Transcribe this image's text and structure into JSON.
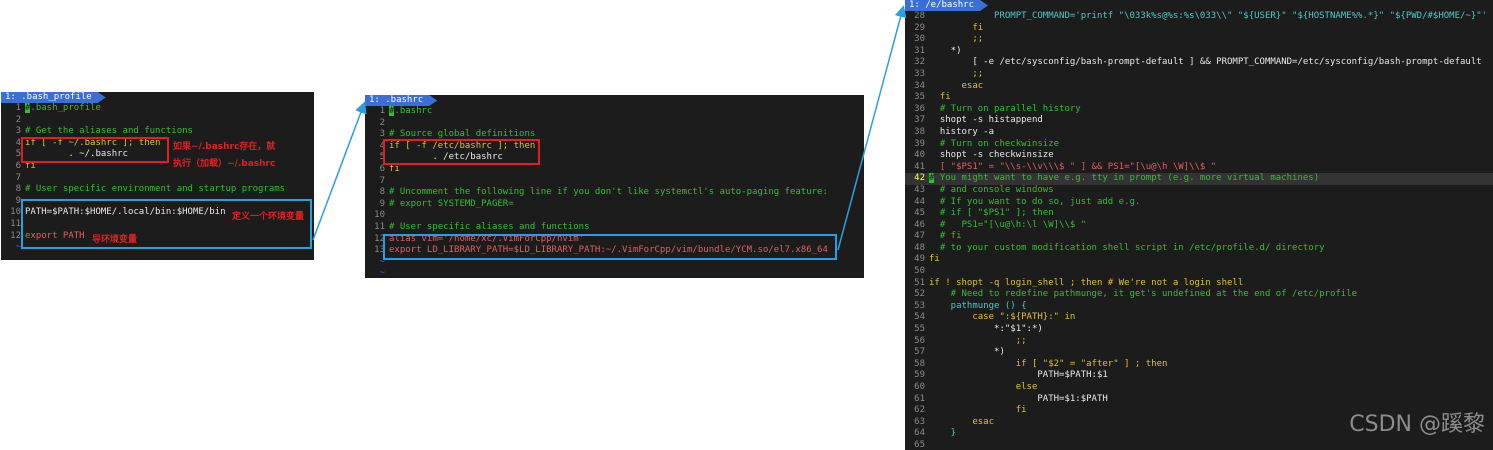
{
  "panel1": {
    "tab": "1: .bash_profile",
    "lines": [
      {
        "n": "1",
        "t": ".bash_profile",
        "c": "cmt",
        "cursor": "#"
      },
      {
        "n": "2",
        "t": "",
        "c": "plain"
      },
      {
        "n": "3",
        "t": "# Get the aliases and functions",
        "c": "cmt"
      },
      {
        "n": "4",
        "t": "if [ -f ~/.bashrc ]; then",
        "c": "kw"
      },
      {
        "n": "5",
        "t": "        . ~/.bashrc",
        "c": "plain"
      },
      {
        "n": "6",
        "t": "fi",
        "c": "kw"
      },
      {
        "n": "7",
        "t": "",
        "c": "plain"
      },
      {
        "n": "8",
        "t": "# User specific environment and startup programs",
        "c": "cmt"
      },
      {
        "n": "9",
        "t": "",
        "c": "plain"
      },
      {
        "n": "10",
        "t": "PATH=$PATH:$HOME/.local/bin:$HOME/bin",
        "c": "plain"
      },
      {
        "n": "11",
        "t": "",
        "c": "plain"
      },
      {
        "n": "12",
        "t": "export PATH",
        "c": "str"
      },
      {
        "n": "~",
        "t": "",
        "c": "tilde"
      }
    ],
    "anno1a": "如果~/.bashrc存在，就",
    "anno1b": "执行（加载）~/.bashrc",
    "anno2": "定义一个环境变量",
    "anno3": "导环境变量"
  },
  "panel2": {
    "tab": "1: .bashrc",
    "lines": [
      {
        "n": "1",
        "t": ".bashrc",
        "c": "cmt",
        "cursor": "#"
      },
      {
        "n": "2",
        "t": "",
        "c": "plain"
      },
      {
        "n": "3",
        "t": "# Source global definitions",
        "c": "cmt"
      },
      {
        "n": "4",
        "t": "if [ -f /etc/bashrc ]; then",
        "c": "kw"
      },
      {
        "n": "5",
        "t": "        . /etc/bashrc",
        "c": "plain"
      },
      {
        "n": "6",
        "t": "fi",
        "c": "kw"
      },
      {
        "n": "7",
        "t": "",
        "c": "plain"
      },
      {
        "n": "8",
        "t": "# Uncomment the following line if you don't like systemctl's auto-paging feature:",
        "c": "cmt"
      },
      {
        "n": "9",
        "t": "# export SYSTEMD_PAGER=",
        "c": "cmt"
      },
      {
        "n": "10",
        "t": "",
        "c": "plain"
      },
      {
        "n": "11",
        "t": "# User specific aliases and functions",
        "c": "cmt"
      },
      {
        "n": "12",
        "t": "alias vim='/home/xc/.VimForCpp/nvim'",
        "c": "str"
      },
      {
        "n": "13",
        "t": "export LD_LIBRARY_PATH=$LD_LIBRARY_PATH:~/.VimForCpp/vim/bundle/YCM.so/el7.x86_64",
        "c": "str"
      },
      {
        "n": "~",
        "t": "",
        "c": "tilde"
      },
      {
        "n": "~",
        "t": "",
        "c": "tilde"
      }
    ]
  },
  "panel3": {
    "tab": "1: /e/bashrc",
    "lines": [
      {
        "n": "28",
        "t": "            PROMPT_COMMAND='printf \"\\033k%s@%s:%s\\033\\\\\" \"${USER}\" \"${HOSTNAME%%.*}\" \"${PWD/#$HOME/~}\"'",
        "c": "cyan"
      },
      {
        "n": "29",
        "t": "        fi",
        "c": "kw"
      },
      {
        "n": "30",
        "t": "        ;;",
        "c": "kw"
      },
      {
        "n": "31",
        "t": "    *)",
        "c": "plain"
      },
      {
        "n": "32",
        "t": "        [ -e /etc/sysconfig/bash-prompt-default ] && PROMPT_COMMAND=/etc/sysconfig/bash-prompt-default",
        "c": "plain"
      },
      {
        "n": "33",
        "t": "        ;;",
        "c": "kw"
      },
      {
        "n": "34",
        "t": "      esac",
        "c": "kw"
      },
      {
        "n": "35",
        "t": "  fi",
        "c": "kw"
      },
      {
        "n": "36",
        "t": "  # Turn on parallel history",
        "c": "cmt"
      },
      {
        "n": "37",
        "t": "  shopt -s histappend",
        "c": "plain"
      },
      {
        "n": "38",
        "t": "  history -a",
        "c": "plain"
      },
      {
        "n": "39",
        "t": "  # Turn on checkwinsize",
        "c": "cmt"
      },
      {
        "n": "40",
        "t": "  shopt -s checkwinsize",
        "c": "plain"
      },
      {
        "n": "41",
        "t": "  [ \"$PS1\" = \"\\\\s-\\\\v\\\\\\$ \" ] && PS1=\"[\\u@\\h \\W]\\\\$ \"",
        "c": "str"
      },
      {
        "n": "42",
        "t": " You might want to have e.g. tty in prompt (e.g. more virtual machines)",
        "c": "cmt",
        "cursor": "#",
        "cur": true
      },
      {
        "n": "43",
        "t": "  # and console windows",
        "c": "cmt"
      },
      {
        "n": "44",
        "t": "  # If you want to do so, just add e.g.",
        "c": "cmt"
      },
      {
        "n": "45",
        "t": "  # if [ \"$PS1\" ]; then",
        "c": "cmt"
      },
      {
        "n": "46",
        "t": "  #   PS1=\"[\\u@\\h:\\l \\W]\\\\$ \"",
        "c": "cmt"
      },
      {
        "n": "47",
        "t": "  # fi",
        "c": "cmt"
      },
      {
        "n": "48",
        "t": "  # to your custom modification shell script in /etc/profile.d/ directory",
        "c": "cmt"
      },
      {
        "n": "49",
        "t": "fi",
        "c": "kw"
      },
      {
        "n": "50",
        "t": "",
        "c": "plain"
      },
      {
        "n": "51",
        "t": "if ! shopt -q login_shell ; then # We're not a login shell",
        "c": "kw"
      },
      {
        "n": "52",
        "t": "    # Need to redefine pathmunge, it get's undefined at the end of /etc/profile",
        "c": "cmt"
      },
      {
        "n": "53",
        "t": "    pathmunge () {",
        "c": "cyan"
      },
      {
        "n": "54",
        "t": "        case \":${PATH}:\" in",
        "c": "kw"
      },
      {
        "n": "55",
        "t": "            *:\"$1\":*)",
        "c": "plain"
      },
      {
        "n": "56",
        "t": "                ;;",
        "c": "kw"
      },
      {
        "n": "57",
        "t": "            *)",
        "c": "plain"
      },
      {
        "n": "58",
        "t": "                if [ \"$2\" = \"after\" ] ; then",
        "c": "kw"
      },
      {
        "n": "59",
        "t": "                    PATH=$PATH:$1",
        "c": "plain"
      },
      {
        "n": "60",
        "t": "                else",
        "c": "kw"
      },
      {
        "n": "61",
        "t": "                    PATH=$1:$PATH",
        "c": "plain"
      },
      {
        "n": "62",
        "t": "                fi",
        "c": "kw"
      },
      {
        "n": "63",
        "t": "        esac",
        "c": "kw"
      },
      {
        "n": "64",
        "t": "    }",
        "c": "cyan"
      },
      {
        "n": "65",
        "t": "",
        "c": "plain"
      }
    ]
  },
  "watermark": "CSDN @蹊黎",
  "colors": {
    "red_box": "#e02020",
    "blue_box": "#2a9fe0",
    "tab": "#3a6fd8",
    "comment": "#30c030"
  }
}
